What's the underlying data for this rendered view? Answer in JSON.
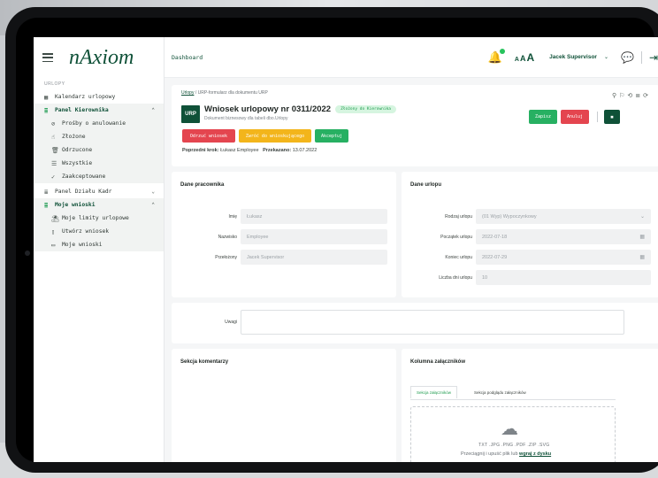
{
  "sidebar": {
    "logo": "nAxiom",
    "section_label": "URLOPY",
    "items": [
      {
        "label": "Kalendarz urlopowy",
        "icon": "calendar-icon"
      },
      {
        "label": "Panel Kierownika",
        "icon": "stack-icon"
      },
      {
        "label": "Prośby o anulowanie",
        "icon": "cancel-icon"
      },
      {
        "label": "Złożone",
        "icon": "hand-icon"
      },
      {
        "label": "Odrzucone",
        "icon": "trash-icon"
      },
      {
        "label": "Wszystkie",
        "icon": "list-icon"
      },
      {
        "label": "Zaakceptowane",
        "icon": "check-icon"
      },
      {
        "label": "Panel Działu Kadr",
        "icon": "stack-icon"
      },
      {
        "label": "Moje wnioski",
        "icon": "stack-icon"
      },
      {
        "label": "Moje limity urlopowe",
        "icon": "beach-icon"
      },
      {
        "label": "Utwórz wniosek",
        "icon": "file-icon"
      },
      {
        "label": "Moje wnioski",
        "icon": "folder-icon"
      }
    ]
  },
  "topbar": {
    "breadcrumb": "Dashboard",
    "font_sizes": [
      "A",
      "A",
      "A"
    ],
    "user": "Jacek Supervisor"
  },
  "request": {
    "crumb_link": "Urlopy",
    "crumb_rest": "URP-formularz dla dokumentu URP",
    "badge": "URP",
    "title": "Wniosek urlopowy nr 0311/2022",
    "status": "Złożony do Kierownika",
    "subtitle": "Dokument biznesowy dla tabeli dbo.Urlopy",
    "actions": {
      "reject": "Odrzuć wniosek",
      "return": "Zwróć do wnioskującego",
      "accept": "Akceptuj",
      "save": "Zapisz",
      "cancel": "Anuluj"
    },
    "prev_label": "Poprzedni krok:",
    "prev_value": "Łukasz Employee",
    "passed_label": "Przekazano:",
    "passed_value": "13.07.2022"
  },
  "employee": {
    "title": "Dane pracownika",
    "fields": [
      {
        "label": "Imię",
        "value": "Łukasz"
      },
      {
        "label": "Nazwisko",
        "value": "Employee"
      },
      {
        "label": "Przełożony",
        "value": "Jacek Supervisor"
      }
    ]
  },
  "leave": {
    "title": "Dane urlopu",
    "fields": [
      {
        "label": "Rodzaj urlopu",
        "value": "(01 Wyp) Wypoczynkowy"
      },
      {
        "label": "Początek urlopu",
        "value": "2022-07-18"
      },
      {
        "label": "Koniec urlopu",
        "value": "2022-07-29"
      },
      {
        "label": "Liczba dni urlopu",
        "value": "10"
      }
    ]
  },
  "notes": {
    "label": "Uwagi"
  },
  "comments": {
    "title": "Sekcja komentarzy"
  },
  "attachments": {
    "title": "Kolumna załączników",
    "tab1": "Sekcja załączników",
    "tab2": "Sekcja podglądu załączników",
    "extensions": "TXT .JPG .PNG .PDF .ZIP .SVG",
    "drop_text": "Przeciągnij i upuść plik lub",
    "drop_link": "wgraj z dysku"
  },
  "colors": {
    "brand": "#0f5138",
    "accent": "#1f9c4f",
    "danger": "#e4454f",
    "warning": "#f3b51b"
  }
}
